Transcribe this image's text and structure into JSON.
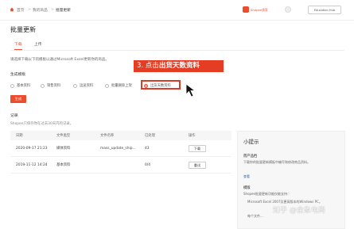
{
  "breadcrumb": {
    "home": "首页",
    "sep": ">",
    "level1": "我的商品",
    "level2": "批量更新"
  },
  "header": {
    "brand": "Shopee卖家",
    "edu_label": "Education Hub",
    "brand_color": "#ee4d2d"
  },
  "page": {
    "title": "批量更新",
    "description": "请选择下载以下的模板以通过Microsoft Excel更新你的商品。"
  },
  "tabs": [
    {
      "label": "下载"
    },
    {
      "label": "上传"
    }
  ],
  "generate": {
    "section_label": "生成模板",
    "options": [
      "基本资料",
      "销售资料",
      "运送资料",
      "批量删除上架",
      "出货天数资料"
    ],
    "selected_index": 4,
    "button_label": "生成"
  },
  "callout": {
    "prefix": "3. 点击",
    "emphasis": "出货天数资料"
  },
  "records": {
    "section_label": "记录",
    "note": "Shopee只保存你在过去30天内的记录。",
    "columns": [
      "日期",
      "文件类型",
      "文件名称",
      "已处理",
      "操作"
    ],
    "rows": [
      {
        "date": "2020-09-17 21:23",
        "type": "媒体资料",
        "name": "mass_update_ship...",
        "processed": "43",
        "action": "下载"
      },
      {
        "date": "2019-11-12 14:24",
        "type": "基本资料",
        "name": "",
        "processed": "0/4",
        "action": "重试"
      }
    ]
  },
  "sidebar": {
    "title": "小提示",
    "sections": [
      {
        "heading": "而产品档",
        "text": "下载你的批量更新模板中编写和修改商品资料。",
        "link": "查看"
      },
      {
        "heading": "模版",
        "text": "Shopee批量更新功能仅能支持："
      }
    ],
    "bullets": [
      "Microsoft Excel 2007及更高版本的Windows PC。",
      "每个文件..."
    ]
  },
  "watermark": "知乎 @金象电商"
}
